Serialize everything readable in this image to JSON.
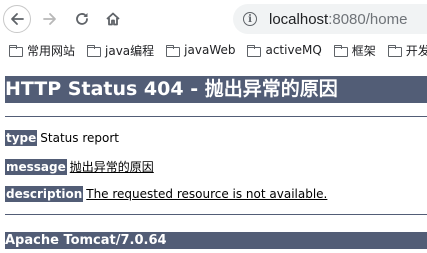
{
  "browser": {
    "url_host": "localhost",
    "url_rest": ":8080/home",
    "info_icon_glyph": "i",
    "bookmarks": [
      {
        "label": "常用网站"
      },
      {
        "label": "java编程"
      },
      {
        "label": "javaWeb"
      },
      {
        "label": "activeMQ"
      },
      {
        "label": "框架"
      },
      {
        "label": "开发"
      }
    ]
  },
  "error_page": {
    "heading": "HTTP Status 404 - 抛出异常的原因",
    "type_key": "type",
    "type_value": "Status report",
    "message_key": "message",
    "message_value": "抛出异常的原因",
    "description_key": "description",
    "description_value": "The requested resource is not available.",
    "server_footer": "Apache Tomcat/7.0.64",
    "accent_color": "#525d76"
  }
}
